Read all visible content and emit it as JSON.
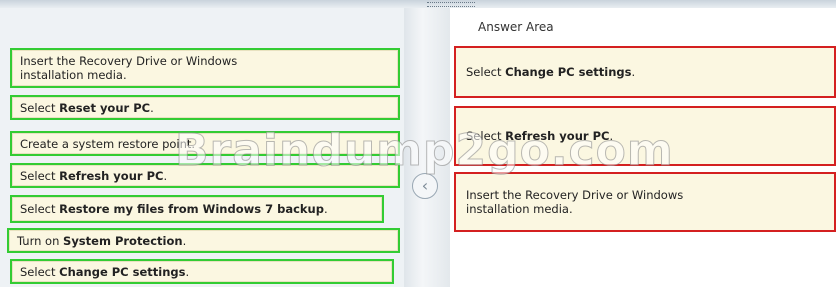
{
  "source_items": [
    {
      "prefix": "Insert the Recovery Drive or Windows installation media.",
      "bold": "",
      "suffix": ""
    },
    {
      "prefix": "Select ",
      "bold": "Reset your PC",
      "suffix": "."
    },
    {
      "prefix": "Create a system restore point.",
      "bold": "",
      "suffix": ""
    },
    {
      "prefix": "Select ",
      "bold": "Refresh your PC",
      "suffix": "."
    },
    {
      "prefix": "Select ",
      "bold": "Restore my files from Windows 7 backup",
      "suffix": "."
    },
    {
      "prefix": "Turn on ",
      "bold": "System Protection",
      "suffix": "."
    },
    {
      "prefix": "Select ",
      "bold": "Change PC settings",
      "suffix": "."
    }
  ],
  "answer_area": {
    "title": "Answer Area",
    "slots": [
      {
        "prefix": "Select ",
        "bold": "Change PC settings",
        "suffix": "."
      },
      {
        "prefix": "Select ",
        "bold": "Refresh your PC",
        "suffix": "."
      },
      {
        "prefix": "Insert the Recovery Drive or Windows installation media.",
        "bold": "",
        "suffix": ""
      }
    ]
  },
  "move_button": {
    "icon": "chevron-left-icon",
    "glyph": "‹"
  },
  "watermark": "Braindump2go.com",
  "colors": {
    "source_border": "#33cc33",
    "slot_border": "#d42020",
    "item_bg": "#fbf7e1"
  }
}
